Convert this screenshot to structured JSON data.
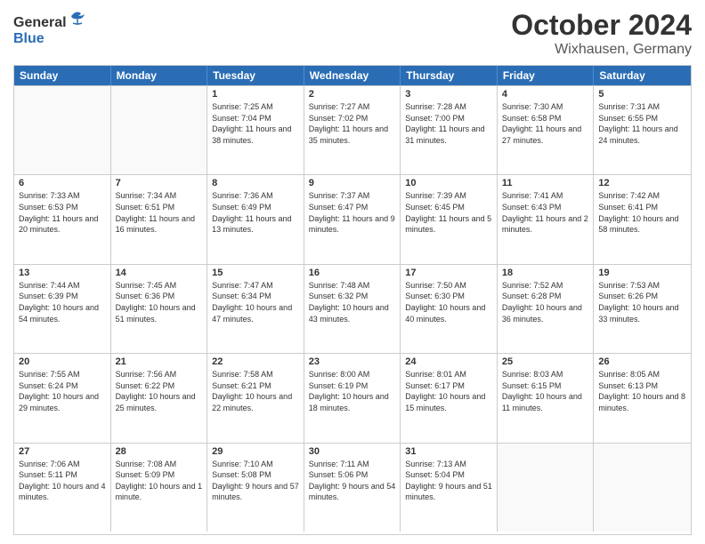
{
  "header": {
    "logo_general": "General",
    "logo_blue": "Blue",
    "month": "October 2024",
    "location": "Wixhausen, Germany"
  },
  "days_of_week": [
    "Sunday",
    "Monday",
    "Tuesday",
    "Wednesday",
    "Thursday",
    "Friday",
    "Saturday"
  ],
  "weeks": [
    [
      {
        "day": "",
        "info": ""
      },
      {
        "day": "",
        "info": ""
      },
      {
        "day": "1",
        "info": "Sunrise: 7:25 AM\nSunset: 7:04 PM\nDaylight: 11 hours and 38 minutes."
      },
      {
        "day": "2",
        "info": "Sunrise: 7:27 AM\nSunset: 7:02 PM\nDaylight: 11 hours and 35 minutes."
      },
      {
        "day": "3",
        "info": "Sunrise: 7:28 AM\nSunset: 7:00 PM\nDaylight: 11 hours and 31 minutes."
      },
      {
        "day": "4",
        "info": "Sunrise: 7:30 AM\nSunset: 6:58 PM\nDaylight: 11 hours and 27 minutes."
      },
      {
        "day": "5",
        "info": "Sunrise: 7:31 AM\nSunset: 6:55 PM\nDaylight: 11 hours and 24 minutes."
      }
    ],
    [
      {
        "day": "6",
        "info": "Sunrise: 7:33 AM\nSunset: 6:53 PM\nDaylight: 11 hours and 20 minutes."
      },
      {
        "day": "7",
        "info": "Sunrise: 7:34 AM\nSunset: 6:51 PM\nDaylight: 11 hours and 16 minutes."
      },
      {
        "day": "8",
        "info": "Sunrise: 7:36 AM\nSunset: 6:49 PM\nDaylight: 11 hours and 13 minutes."
      },
      {
        "day": "9",
        "info": "Sunrise: 7:37 AM\nSunset: 6:47 PM\nDaylight: 11 hours and 9 minutes."
      },
      {
        "day": "10",
        "info": "Sunrise: 7:39 AM\nSunset: 6:45 PM\nDaylight: 11 hours and 5 minutes."
      },
      {
        "day": "11",
        "info": "Sunrise: 7:41 AM\nSunset: 6:43 PM\nDaylight: 11 hours and 2 minutes."
      },
      {
        "day": "12",
        "info": "Sunrise: 7:42 AM\nSunset: 6:41 PM\nDaylight: 10 hours and 58 minutes."
      }
    ],
    [
      {
        "day": "13",
        "info": "Sunrise: 7:44 AM\nSunset: 6:39 PM\nDaylight: 10 hours and 54 minutes."
      },
      {
        "day": "14",
        "info": "Sunrise: 7:45 AM\nSunset: 6:36 PM\nDaylight: 10 hours and 51 minutes."
      },
      {
        "day": "15",
        "info": "Sunrise: 7:47 AM\nSunset: 6:34 PM\nDaylight: 10 hours and 47 minutes."
      },
      {
        "day": "16",
        "info": "Sunrise: 7:48 AM\nSunset: 6:32 PM\nDaylight: 10 hours and 43 minutes."
      },
      {
        "day": "17",
        "info": "Sunrise: 7:50 AM\nSunset: 6:30 PM\nDaylight: 10 hours and 40 minutes."
      },
      {
        "day": "18",
        "info": "Sunrise: 7:52 AM\nSunset: 6:28 PM\nDaylight: 10 hours and 36 minutes."
      },
      {
        "day": "19",
        "info": "Sunrise: 7:53 AM\nSunset: 6:26 PM\nDaylight: 10 hours and 33 minutes."
      }
    ],
    [
      {
        "day": "20",
        "info": "Sunrise: 7:55 AM\nSunset: 6:24 PM\nDaylight: 10 hours and 29 minutes."
      },
      {
        "day": "21",
        "info": "Sunrise: 7:56 AM\nSunset: 6:22 PM\nDaylight: 10 hours and 25 minutes."
      },
      {
        "day": "22",
        "info": "Sunrise: 7:58 AM\nSunset: 6:21 PM\nDaylight: 10 hours and 22 minutes."
      },
      {
        "day": "23",
        "info": "Sunrise: 8:00 AM\nSunset: 6:19 PM\nDaylight: 10 hours and 18 minutes."
      },
      {
        "day": "24",
        "info": "Sunrise: 8:01 AM\nSunset: 6:17 PM\nDaylight: 10 hours and 15 minutes."
      },
      {
        "day": "25",
        "info": "Sunrise: 8:03 AM\nSunset: 6:15 PM\nDaylight: 10 hours and 11 minutes."
      },
      {
        "day": "26",
        "info": "Sunrise: 8:05 AM\nSunset: 6:13 PM\nDaylight: 10 hours and 8 minutes."
      }
    ],
    [
      {
        "day": "27",
        "info": "Sunrise: 7:06 AM\nSunset: 5:11 PM\nDaylight: 10 hours and 4 minutes."
      },
      {
        "day": "28",
        "info": "Sunrise: 7:08 AM\nSunset: 5:09 PM\nDaylight: 10 hours and 1 minute."
      },
      {
        "day": "29",
        "info": "Sunrise: 7:10 AM\nSunset: 5:08 PM\nDaylight: 9 hours and 57 minutes."
      },
      {
        "day": "30",
        "info": "Sunrise: 7:11 AM\nSunset: 5:06 PM\nDaylight: 9 hours and 54 minutes."
      },
      {
        "day": "31",
        "info": "Sunrise: 7:13 AM\nSunset: 5:04 PM\nDaylight: 9 hours and 51 minutes."
      },
      {
        "day": "",
        "info": ""
      },
      {
        "day": "",
        "info": ""
      }
    ]
  ]
}
